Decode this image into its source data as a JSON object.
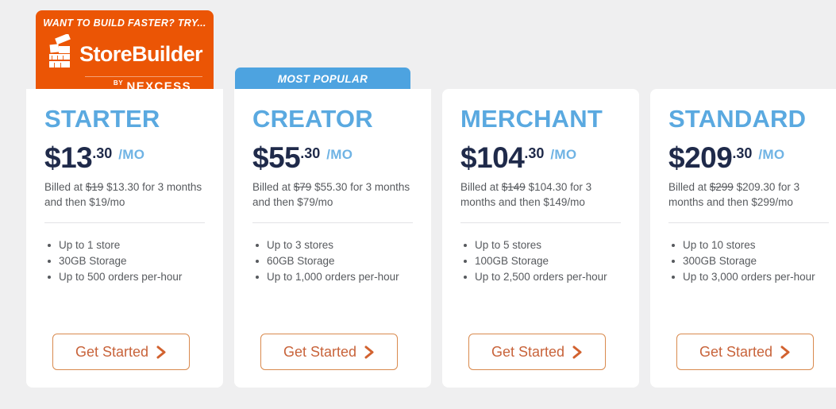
{
  "promo_banner": {
    "tagline": "WANT TO BUILD FASTER? TRY...",
    "wordmark": "StoreBuilder",
    "by_label": "BY",
    "brand": "NEXCESS",
    "bg_color": "#eb5505",
    "logo_icon": "storebuilder-blocks-icon"
  },
  "popular_badge": {
    "label": "MOST POPULAR",
    "bg_color": "#4da3e0"
  },
  "colors": {
    "plan_heading": "#5aa9e0",
    "price": "#1f2a4a",
    "per_month": "#6fb3e4",
    "cta_border": "#d98a4e",
    "cta_text": "#c8633a",
    "page_bg": "#efeff0"
  },
  "plans": [
    {
      "name": "STARTER",
      "price_main": "$13",
      "price_cents": ".30",
      "per": "/MO",
      "billing_prefix": "Billed at ",
      "billing_strike": "$19",
      "billing_suffix": " $13.30 for 3 months and then $19/mo",
      "features": [
        "Up to 1 store",
        "30GB Storage",
        "Up to 500 orders per-hour"
      ],
      "cta_label": "Get Started"
    },
    {
      "name": "CREATOR",
      "price_main": "$55",
      "price_cents": ".30",
      "per": "/MO",
      "billing_prefix": "Billed at ",
      "billing_strike": "$79",
      "billing_suffix": " $55.30 for 3 months and then $79/mo",
      "features": [
        "Up to 3 stores",
        "60GB Storage",
        "Up to 1,000 orders per-hour"
      ],
      "cta_label": "Get Started"
    },
    {
      "name": "MERCHANT",
      "price_main": "$104",
      "price_cents": ".30",
      "per": "/MO",
      "billing_prefix": "Billed at ",
      "billing_strike": "$149",
      "billing_suffix": " $104.30 for 3 months and then $149/mo",
      "features": [
        "Up to 5 stores",
        "100GB Storage",
        "Up to 2,500 orders per-hour"
      ],
      "cta_label": "Get Started"
    },
    {
      "name": "STANDARD",
      "price_main": "$209",
      "price_cents": ".30",
      "per": "/MO",
      "billing_prefix": "Billed at ",
      "billing_strike": "$299",
      "billing_suffix": " $209.30 for 3 months and then $299/mo",
      "features": [
        "Up to 10 stores",
        "300GB Storage",
        "Up to 3,000 orders per-hour"
      ],
      "cta_label": "Get Started"
    }
  ]
}
